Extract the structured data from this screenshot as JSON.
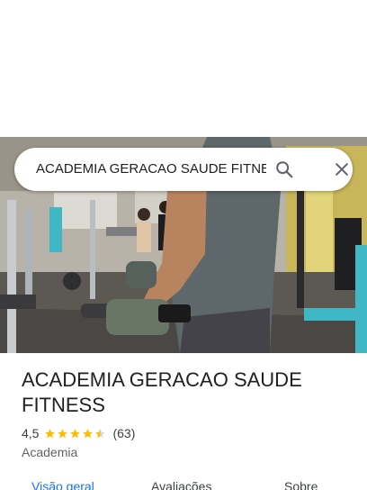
{
  "search": {
    "query": "ACADEMIA GERACAO SAUDE FITNE",
    "search_icon": "search-icon",
    "close_icon": "close-icon"
  },
  "hero_photo": {
    "description_icon": "gym-photo"
  },
  "place": {
    "title": "ACADEMIA GERACAO SAUDE FITNESS",
    "rating": "4,5",
    "stars_value": 4.5,
    "review_count": "(63)",
    "category": "Academia"
  },
  "tabs": [
    {
      "label": "Visão geral",
      "active": true
    },
    {
      "label": "Avaliações",
      "active": false
    },
    {
      "label": "Sobre",
      "active": false
    }
  ],
  "colors": {
    "accent": "#1a73e8",
    "star": "#fbbc04",
    "text": "#202124"
  }
}
